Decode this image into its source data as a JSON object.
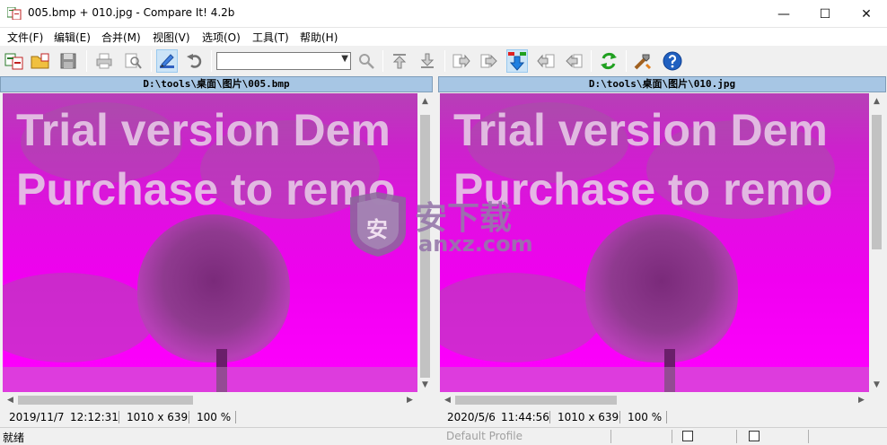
{
  "window": {
    "title": "005.bmp + 010.jpg - Compare It! 4.2b",
    "minimize_glyph": "—",
    "maximize_glyph": "☐",
    "close_glyph": "✕"
  },
  "menu": [
    "文件(F)",
    "编辑(E)",
    "合并(M)",
    "视图(V)",
    "选项(O)",
    "工具(T)",
    "帮助(H)"
  ],
  "toolbar": {
    "combo_value": "",
    "buttons": [
      "open-files",
      "open-folder",
      "save",
      "print",
      "print-preview",
      "edit",
      "undo",
      "find",
      "first-change",
      "last-change",
      "copy-right",
      "copy-right-all",
      "next-change",
      "copy-left",
      "copy-left-all",
      "refresh",
      "tools",
      "help"
    ]
  },
  "left_pane": {
    "header": "D:\\tools\\桌面\\图片\\005.bmp",
    "date": "2019/11/7",
    "time": "12:12:31",
    "size": "1010 x 639",
    "zoom": "100 %"
  },
  "right_pane": {
    "header": "D:\\tools\\桌面\\图片\\010.jpg",
    "date": "2020/5/6",
    "time": "11:44:56",
    "size": "1010 x 639",
    "zoom": "100 %"
  },
  "watermark": {
    "line1": "Trial version Dem",
    "line2": "Purchase to remo"
  },
  "site_logo": {
    "badge_char": "安",
    "name": "安下载",
    "url": "anxz.com"
  },
  "statusbar": {
    "ready": "就绪",
    "profile": "Default Profile"
  },
  "colors": {
    "image_tint": "#ff00ff",
    "header_bg": "#a7c6e4",
    "active_button_bg": "#cce4f7"
  }
}
